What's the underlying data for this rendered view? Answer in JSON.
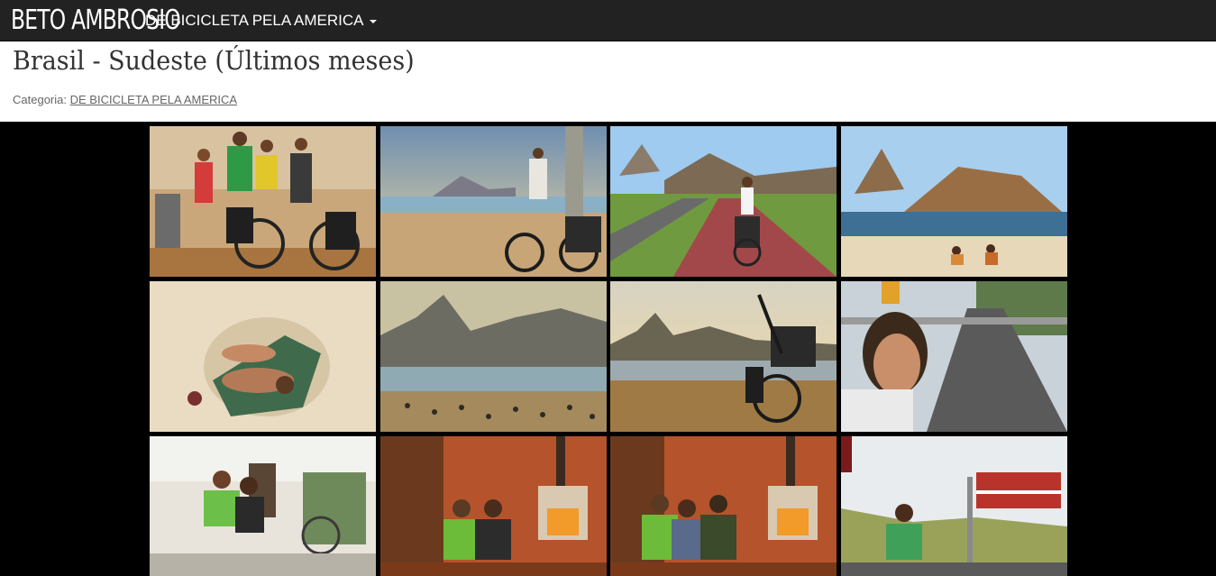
{
  "navbar": {
    "brand": "BETO AMBROSIO",
    "menu_label": "DE BICICLETA PELA AMERICA"
  },
  "post": {
    "title": "Brasil - Sudeste (Últimos meses)",
    "category_label": "Categoria:",
    "category_link": "DE BICICLETA PELA AMERICA"
  },
  "colors": {
    "navbar_bg": "#222222",
    "gallery_bg": "#000000",
    "title_text": "#333333"
  },
  "gallery": {
    "photos": [
      {
        "subject": "group-with-bicycle-photo"
      },
      {
        "subject": "ipanema-beach-sunset-photo"
      },
      {
        "subject": "sugarloaf-bike-path-photo"
      },
      {
        "subject": "sugarloaf-beach-photo"
      },
      {
        "subject": "couple-lying-on-sand-photo"
      },
      {
        "subject": "ipanema-beach-mountains-photo"
      },
      {
        "subject": "bicycle-on-beach-sunset-photo"
      },
      {
        "subject": "selfie-on-highway-photo"
      },
      {
        "subject": "couple-sitting-at-house-photo"
      },
      {
        "subject": "two-men-by-fireplace-photo"
      },
      {
        "subject": "three-friends-by-fireplace-photo"
      },
      {
        "subject": "novadutra-sign-photo"
      }
    ]
  }
}
